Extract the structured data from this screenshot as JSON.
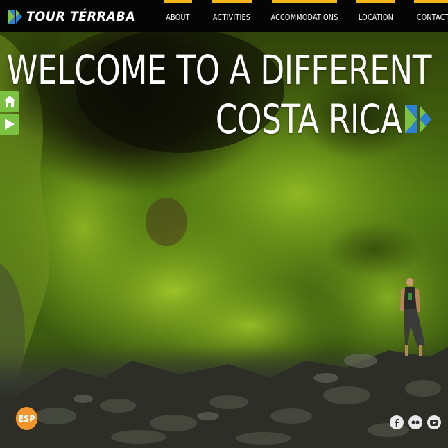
{
  "brand": {
    "name": "TOUR TÉRRABA"
  },
  "nav": {
    "items": [
      {
        "label": "ABOUT"
      },
      {
        "label": "ACTIVITIES"
      },
      {
        "label": "ACCOMMODATIONS"
      },
      {
        "label": "LOCATION"
      },
      {
        "label": "CONTACT"
      }
    ]
  },
  "hero": {
    "line1": "WELCOME TO A DIFFERENT",
    "line2": "COSTA RICA"
  },
  "side_buttons": [
    {
      "icon": "home-icon"
    },
    {
      "icon": "play-icon"
    }
  ],
  "language": {
    "label": "ESP"
  },
  "social": [
    {
      "icon": "facebook-icon"
    },
    {
      "icon": "flickr-icon"
    },
    {
      "icon": "youtube-icon"
    }
  ],
  "colors": {
    "accent": "#f2b418",
    "green": "#7cc242",
    "blue": "#2e7fd6",
    "orange": "#f0962b",
    "header_bg": "#050505"
  }
}
